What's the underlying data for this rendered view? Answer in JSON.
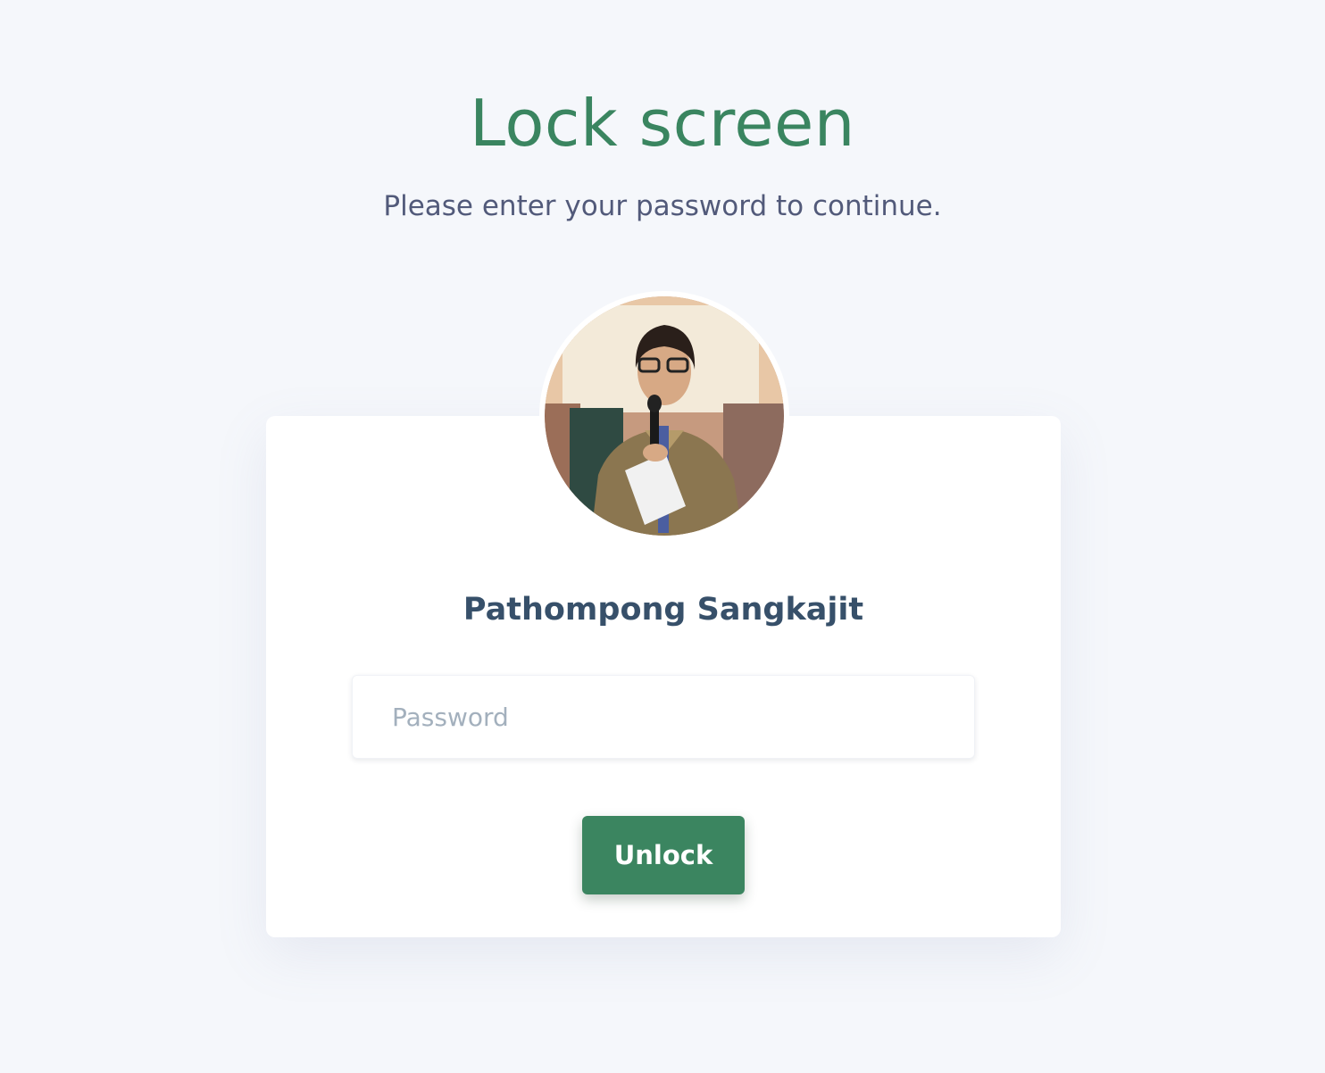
{
  "page": {
    "title": "Lock screen",
    "subtitle": "Please enter your password to continue."
  },
  "user": {
    "name": "Pathompong Sangkajit",
    "avatar_description": "user-avatar-photo"
  },
  "form": {
    "password_placeholder": "Password",
    "password_value": "",
    "unlock_label": "Unlock"
  },
  "colors": {
    "accent": "#3b8560",
    "title": "#3a8560",
    "subtitle": "#525a7a",
    "username": "#37506a",
    "background": "#f5f7fb",
    "card": "#ffffff",
    "placeholder": "#a3b0bd"
  }
}
